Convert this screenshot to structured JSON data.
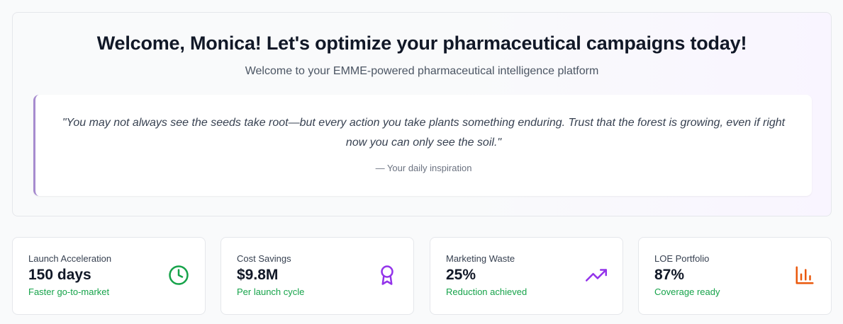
{
  "hero": {
    "title": "Welcome, Monica! Let's optimize your pharmaceutical campaigns today!",
    "subtitle": "Welcome to your EMME-powered pharmaceutical intelligence platform",
    "quote": {
      "line1": "\"You may not always see the seeds take root—but every action you take plants something enduring. Trust that the forest is growing, even if right",
      "line2": "now you can only see the soil.\"",
      "attribution": "— Your daily inspiration"
    }
  },
  "stats": [
    {
      "label": "Launch Acceleration",
      "value": "150 days",
      "note": "Faster go-to-market",
      "icon": "clock-icon",
      "icon_color": "#16a34a"
    },
    {
      "label": "Cost Savings",
      "value": "$9.8M",
      "note": "Per launch cycle",
      "icon": "award-icon",
      "icon_color": "#9333ea"
    },
    {
      "label": "Marketing Waste",
      "value": "25%",
      "note": "Reduction achieved",
      "icon": "trending-up-icon",
      "icon_color": "#9333ea"
    },
    {
      "label": "LOE Portfolio",
      "value": "87%",
      "note": "Coverage ready",
      "icon": "bar-chart-icon",
      "icon_color": "#ea580c"
    }
  ],
  "colors": {
    "accent_green": "#16a34a",
    "accent_purple": "#9333ea",
    "accent_orange": "#ea580c",
    "quote_border": "#a78bcf"
  }
}
